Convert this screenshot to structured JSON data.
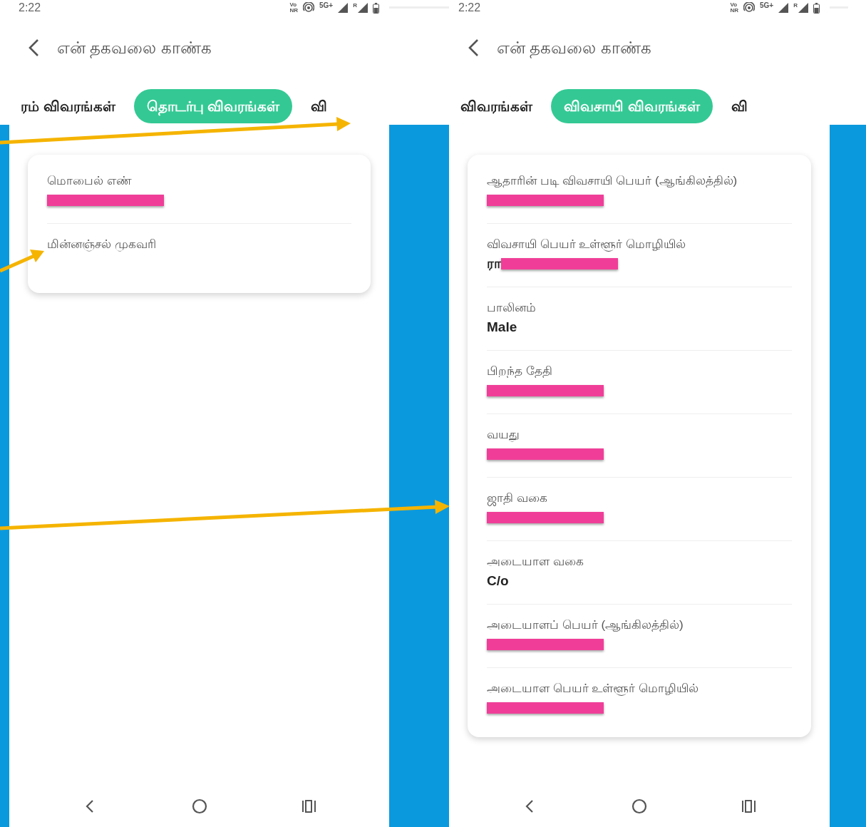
{
  "phones": [
    {
      "status_bar": {
        "time": "2:22",
        "call_label_top": "Vo",
        "call_label_bottom": "NR",
        "network": "5G+",
        "roaming": "R"
      },
      "header": {
        "title": "என் தகவலை காண்க"
      },
      "tabs": [
        {
          "label": "ரம் விவரங்கள்",
          "selected": false
        },
        {
          "label": "தொடர்பு விவரங்கள்",
          "selected": true
        },
        {
          "label": "வி",
          "selected": false
        }
      ],
      "fields": [
        {
          "label": "மொபைல் எண்",
          "redacted": true
        },
        {
          "label": "மின்னஞ்சல் முகவரி"
        }
      ]
    },
    {
      "status_bar": {
        "time": "2:22",
        "call_label_top": "Vo",
        "call_label_bottom": "NR",
        "network": "5G+",
        "roaming": "R"
      },
      "header": {
        "title": "என் தகவலை காண்க"
      },
      "tabs": [
        {
          "label": "விவரங்கள்",
          "selected": false
        },
        {
          "label": "விவசாயி விவரங்கள்",
          "selected": true
        },
        {
          "label": "வி",
          "selected": false
        }
      ],
      "fields": [
        {
          "label": "ஆதாரின் படி விவசாயி பெயர் (ஆங்கிலத்தில்)",
          "redacted": true
        },
        {
          "label": "விவசாயி பெயர் உள்ளூர் மொழியில்",
          "value": "ரா",
          "redacted": true
        },
        {
          "label": "பாலினம்",
          "value": "Male"
        },
        {
          "label": "பிறந்த தேதி",
          "redacted": true
        },
        {
          "label": "வயது",
          "redacted": true
        },
        {
          "label": "ஜாதி வகை",
          "redacted": true
        },
        {
          "label": "அடையாள வகை",
          "value": "C/o"
        },
        {
          "label": "அடையாளப் பெயர் (ஆங்கிலத்தில்)",
          "redacted": true
        },
        {
          "label": "அடையாள பெயர் உள்ளூர் மொழியில்",
          "redacted": true
        }
      ]
    }
  ]
}
